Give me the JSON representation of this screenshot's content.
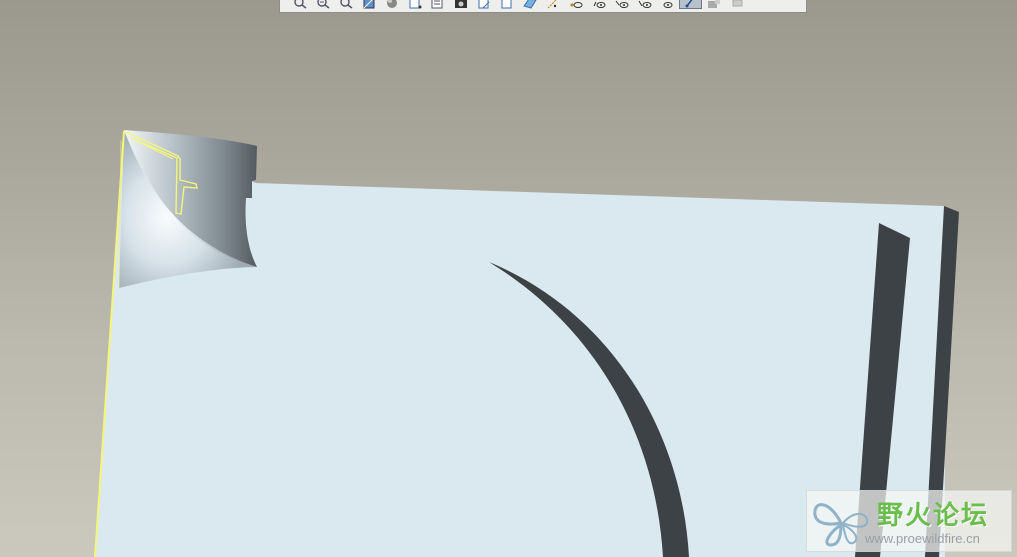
{
  "app": {
    "type": "3D CAD viewport",
    "background_top": "#9b998d",
    "background_bottom": "#cbc9be"
  },
  "toolbar": {
    "buttons": [
      {
        "icon": "zoom-window-icon"
      },
      {
        "icon": "zoom-in-icon"
      },
      {
        "icon": "zoom-out-icon"
      },
      {
        "icon": "refit-icon"
      },
      {
        "icon": "shading-icon"
      },
      {
        "icon": "view-orient-icon"
      },
      {
        "icon": "saved-views-icon"
      },
      {
        "icon": "camera-icon"
      },
      {
        "icon": "layer-icon"
      },
      {
        "icon": "model-tree-icon"
      },
      {
        "icon": "datum-plane-icon"
      },
      {
        "icon": "datum-axis-icon"
      },
      {
        "icon": "datum-point-icon"
      },
      {
        "icon": "datum-csys-icon"
      },
      {
        "icon": "annotation-icon"
      },
      {
        "icon": "spin-center-icon"
      },
      {
        "icon": "sketch-display-icon",
        "active": true
      },
      {
        "icon": "display-style-icon"
      },
      {
        "icon": "settings-icon"
      }
    ]
  },
  "model": {
    "face_color": "#dae8f0",
    "edge_color": "#3c4246",
    "highlight_color": "#f5f57a"
  },
  "watermark": {
    "title": "野火论坛",
    "url": "www.proewildfire.cn",
    "title_color": "#6bbe4e"
  }
}
